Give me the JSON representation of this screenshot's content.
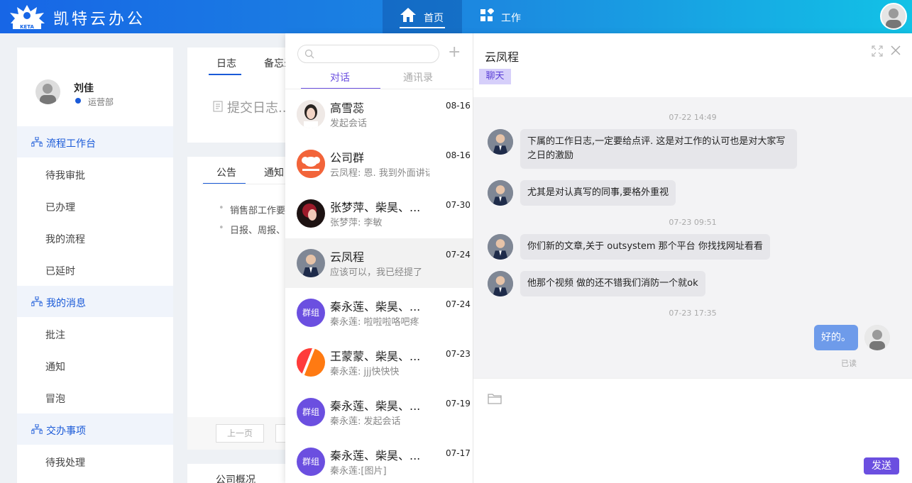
{
  "header": {
    "app_title": "凯特云办公",
    "logo_text": "KETA",
    "nav": [
      {
        "label": "首页",
        "icon": "home-icon"
      },
      {
        "label": "工作",
        "icon": "grid-icon"
      }
    ]
  },
  "sidebar": {
    "profile": {
      "name": "刘佳",
      "department": "运营部"
    },
    "sections": [
      {
        "label": "流程工作台",
        "items": [
          "待我审批",
          "已办理",
          "我的流程",
          "已延时"
        ]
      },
      {
        "label": "我的消息",
        "items": [
          "批注",
          "通知",
          "冒泡"
        ]
      },
      {
        "label": "交办事项",
        "items": [
          "待我处理"
        ]
      }
    ]
  },
  "main": {
    "log_tabs": [
      "日志",
      "备忘录"
    ],
    "submit_log": "提交日志...",
    "notice_tabs": [
      "公告",
      "通知"
    ],
    "notices": [
      "销售部工作要求",
      "日报、周报、"
    ],
    "pager": {
      "prev": "上一页"
    },
    "company_tab": "公司概况"
  },
  "chat_list": {
    "search": {
      "placeholder": ""
    },
    "tabs": [
      "对话",
      "通讯录"
    ],
    "conversations": [
      {
        "name": "高雪蕊",
        "time": "08-16",
        "last": "发起会话"
      },
      {
        "name": "公司群",
        "time": "08-16",
        "last": "云凤程: 恩. 我到外面讲话"
      },
      {
        "name": "张梦萍、柴昊、...",
        "time": "07-30",
        "last": "张梦萍: 李敏"
      },
      {
        "name": "云凤程",
        "time": "07-24",
        "last": "应该可以，我已经提了"
      },
      {
        "name": "秦永莲、柴昊、...",
        "time": "07-24",
        "last": "秦永莲: 啦啦啦咯吧疼",
        "avatar_text": "群组"
      },
      {
        "name": "王蒙蒙、柴昊、...",
        "time": "07-23",
        "last": "秦永莲: jjj快快快"
      },
      {
        "name": "秦永莲、柴昊、...",
        "time": "07-19",
        "last": "秦永莲: 发起会话",
        "avatar_text": "群组"
      },
      {
        "name": "秦永莲、柴昊、...",
        "time": "07-17",
        "last": "秦永莲:[图片]",
        "avatar_text": "群组"
      }
    ]
  },
  "chat": {
    "title": "云凤程",
    "tag": "聊天",
    "timestamps": [
      "07-22 14:49",
      "07-23 09:51",
      "07-23 17:35"
    ],
    "messages": [
      "下属的工作日志,一定要给点评. 这是对工作的认可也是对大家写之日的激励",
      "尤其是对认真写的同事,要格外重视",
      "你们新的文章,关于 outsystem 那个平台 你找找网址看看",
      "他那个视频 做的还不错我们消防一个就ok",
      "好的。"
    ],
    "read_status": "已读",
    "send_label": "发送"
  },
  "colors": {
    "header_start": "#1766e6",
    "header_end": "#12c2e6",
    "accent": "#6b4fe0",
    "sidebar_accent": "#1a5ad8",
    "my_bubble": "#6e9bea"
  }
}
